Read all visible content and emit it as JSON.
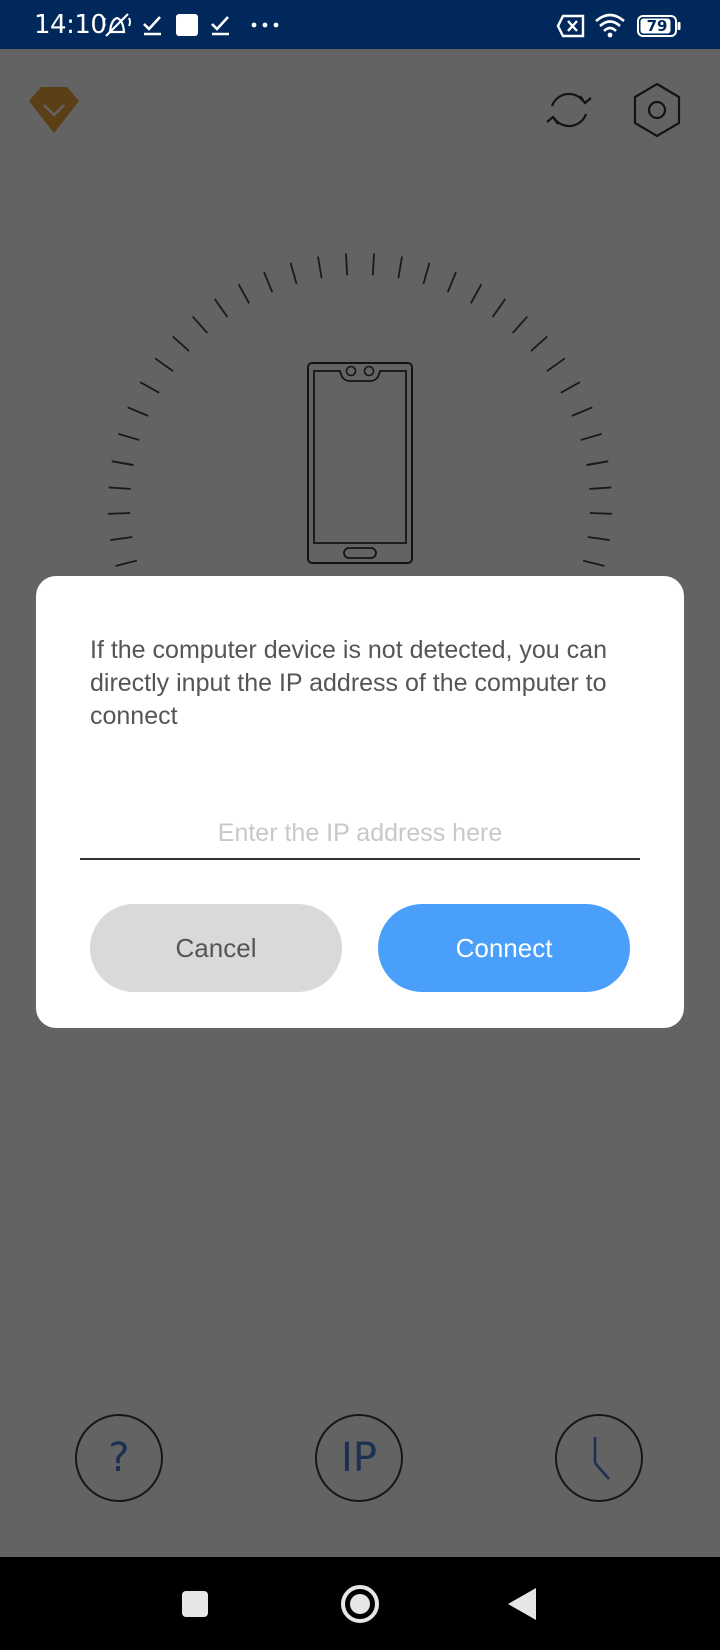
{
  "status_bar": {
    "time": "14:10",
    "battery": "79",
    "left_icons": [
      "muted-bell-icon",
      "check-icon",
      "square-icon",
      "check-icon",
      "more-dots-icon"
    ],
    "right_icons": [
      "sim-x-icon",
      "wifi-icon",
      "battery-icon"
    ]
  },
  "app": {
    "top_icons": [
      "premium-gem-icon",
      "refresh-icon",
      "settings-hex-icon"
    ],
    "center_icon": "phone-icon",
    "bottom_buttons": [
      {
        "label": "?",
        "icon": "help-icon"
      },
      {
        "label": "IP",
        "icon": "ip-icon"
      },
      {
        "label": "",
        "icon": "history-icon"
      }
    ],
    "accent_color": "#4a9ffb",
    "gem_color": "#e8a33c"
  },
  "dialog": {
    "message": "If the computer device is not detected, you can directly input the IP address of the computer to connect",
    "input_value": "",
    "input_placeholder": "Enter the IP address here",
    "cancel_label": "Cancel",
    "connect_label": "Connect"
  },
  "nav_bar": {
    "icons": [
      "recents-square-icon",
      "home-circle-icon",
      "back-triangle-icon"
    ]
  }
}
